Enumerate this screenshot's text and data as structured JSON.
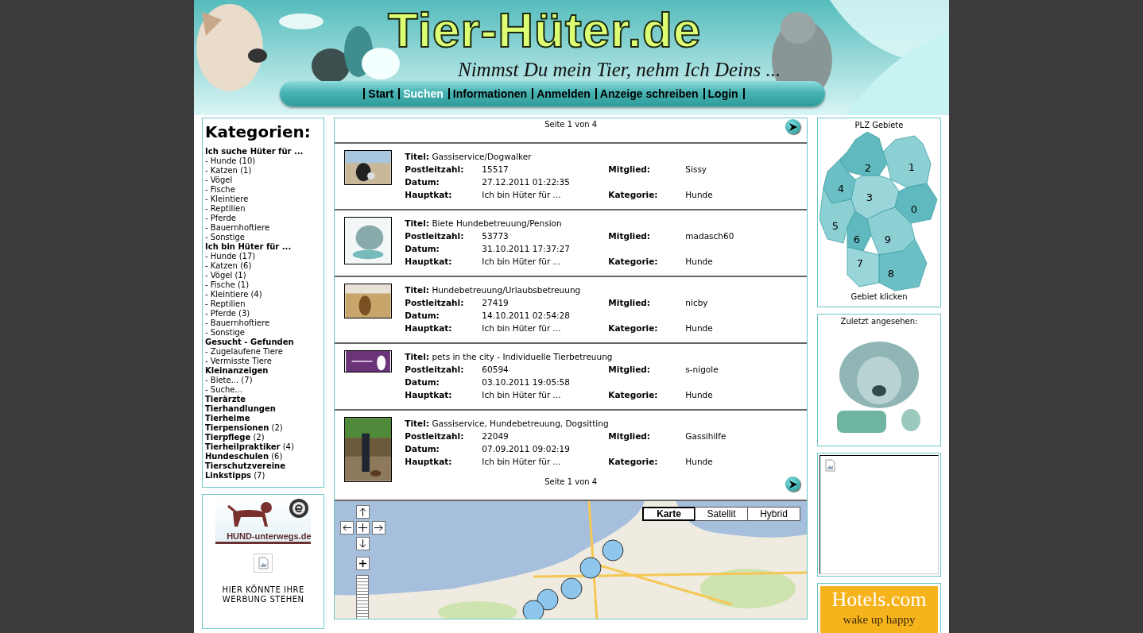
{
  "header": {
    "logo": "Tier-Hüter.de",
    "slogan": "Nimmst Du mein Tier, nehm Ich Deins ...",
    "nav": [
      {
        "label": "Start",
        "selected": false
      },
      {
        "label": "Suchen",
        "selected": true
      },
      {
        "label": "Informationen",
        "selected": false
      },
      {
        "label": "Anmelden",
        "selected": false
      },
      {
        "label": "Anzeige schreiben",
        "selected": false
      },
      {
        "label": "Login",
        "selected": false
      }
    ]
  },
  "sidebar": {
    "title": "Kategorien:",
    "categories": [
      {
        "label": "Ich suche Hüter für ...",
        "children": [
          {
            "label": "- Hunde (10)"
          },
          {
            "label": "- Katzen (1)"
          },
          {
            "label": "- Vögel"
          },
          {
            "label": "- Fische"
          },
          {
            "label": "- Kleintiere"
          },
          {
            "label": "- Reptilien"
          },
          {
            "label": "- Pferde"
          },
          {
            "label": "- Bauernhoftiere"
          },
          {
            "label": "- Sonstige"
          }
        ]
      },
      {
        "label": "Ich bin Hüter für ...",
        "children": [
          {
            "label": "- Hunde (17)"
          },
          {
            "label": "- Katzen (6)"
          },
          {
            "label": "- Vögel (1)"
          },
          {
            "label": "- Fische (1)"
          },
          {
            "label": "- Kleintiere (4)"
          },
          {
            "label": "- Reptilien"
          },
          {
            "label": "- Pferde (3)"
          },
          {
            "label": "- Bauernhoftiere"
          },
          {
            "label": "- Sonstige"
          }
        ]
      },
      {
        "label": "Gesucht - Gefunden",
        "children": [
          {
            "label": "- Zugelaufene Tiere"
          },
          {
            "label": "- Vermisste Tiere"
          }
        ]
      },
      {
        "label": "Kleinanzeigen",
        "children": [
          {
            "label": "- Biete... (7)"
          },
          {
            "label": "- Suche..."
          }
        ]
      },
      {
        "label": "Tierärzte"
      },
      {
        "label": "Tierhandlungen"
      },
      {
        "label": "Tierheime"
      },
      {
        "label": "Tierpensionen",
        "count": "(2)"
      },
      {
        "label": "Tierpflege",
        "count": "(2)"
      },
      {
        "label": "Tierheilpraktiker",
        "count": "(4)"
      },
      {
        "label": "Hundeschulen",
        "count": "(6)"
      },
      {
        "label": "Tierschutzvereine"
      },
      {
        "label": "Linkstipps",
        "count": "(7)"
      }
    ]
  },
  "ad_box": {
    "banner_text": "HUND-unterwegs.de",
    "note": "HIER KÖNNTE IHRE WERBUNG STEHEN"
  },
  "pager_top": "Seite 1 von 4",
  "listings": [
    {
      "title_label": "Titel:",
      "title": "Gassiservice/Dogwalker",
      "lines": [
        [
          {
            "label": "Postleitzahl:",
            "value": "15517"
          },
          {
            "label": "Mitglied:",
            "value": "Sissy"
          }
        ],
        [
          {
            "label": "Datum:",
            "value": "27.12.2011 01:22:35"
          }
        ],
        [
          {
            "label": "Hauptkat:",
            "value": "Ich bin Hüter für ..."
          },
          {
            "label": "Kategorie:",
            "value": "Hunde"
          }
        ]
      ]
    },
    {
      "title_label": "Titel:",
      "title": "Biete Hundebetreuung/Pension",
      "lines": [
        [
          {
            "label": "Postleitzahl:",
            "value": "53773"
          },
          {
            "label": "Mitglied:",
            "value": "madasch60"
          }
        ],
        [
          {
            "label": "Datum:",
            "value": "31.10.2011 17:37:27"
          }
        ],
        [
          {
            "label": "Hauptkat:",
            "value": "Ich bin Hüter für ..."
          },
          {
            "label": "Kategorie:",
            "value": "Hunde"
          }
        ]
      ]
    },
    {
      "title_label": "Titel:",
      "title": "Hundebetreuung/Urlaubsbetreuung",
      "lines": [
        [
          {
            "label": "Postleitzahl:",
            "value": "27419"
          },
          {
            "label": "Mitglied:",
            "value": "nicby"
          }
        ],
        [
          {
            "label": "Datum:",
            "value": "14.10.2011 02:54:28"
          }
        ],
        [
          {
            "label": "Hauptkat:",
            "value": "Ich bin Hüter für ..."
          },
          {
            "label": "Kategorie:",
            "value": "Hunde"
          }
        ]
      ]
    },
    {
      "title_label": "Titel:",
      "title": "pets in the city - Individuelle Tierbetreuung",
      "lines": [
        [
          {
            "label": "Postleitzahl:",
            "value": "60594"
          },
          {
            "label": "Mitglied:",
            "value": "s-nigole"
          }
        ],
        [
          {
            "label": "Datum:",
            "value": "03.10.2011 19:05:58"
          }
        ],
        [
          {
            "label": "Hauptkat:",
            "value": "Ich bin Hüter für ..."
          },
          {
            "label": "Kategorie:",
            "value": "Hunde"
          }
        ]
      ]
    },
    {
      "title_label": "Titel:",
      "title": "Gassiservice, Hundebetreuung, Dogsitting",
      "lines": [
        [
          {
            "label": "Postleitzahl:",
            "value": "22049"
          },
          {
            "label": "Mitglied:",
            "value": "Gassihilfe"
          }
        ],
        [
          {
            "label": "Datum:",
            "value": "07.09.2011 09:02:19"
          }
        ],
        [
          {
            "label": "Hauptkat:",
            "value": "Ich bin Hüter für ..."
          },
          {
            "label": "Kategorie:",
            "value": "Hunde"
          }
        ]
      ]
    }
  ],
  "pager_bottom": "Seite 1 von 4",
  "map": {
    "types": [
      {
        "label": "Karte",
        "selected": true
      },
      {
        "label": "Satellit",
        "selected": false
      },
      {
        "label": "Hybrid",
        "selected": false
      }
    ]
  },
  "plz_box": {
    "title": "PLZ Gebiete",
    "regions": [
      {
        "label": "2"
      },
      {
        "label": "1"
      },
      {
        "label": "4"
      },
      {
        "label": "3"
      },
      {
        "label": "0"
      },
      {
        "label": "5"
      },
      {
        "label": "6"
      },
      {
        "label": "9"
      },
      {
        "label": "7"
      },
      {
        "label": "8"
      }
    ],
    "hint": "Gebiet klicken"
  },
  "recent_box": {
    "title": "Zuletzt angesehen:"
  },
  "hotels_ad": {
    "brand": "Hotels.com",
    "tagline": "wake up happy"
  }
}
